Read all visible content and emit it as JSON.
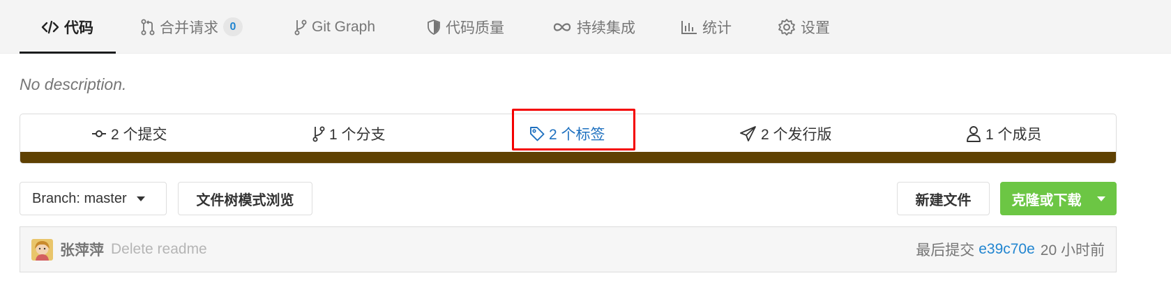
{
  "tabs": [
    {
      "label": "代码",
      "icon": "code-icon",
      "active": true
    },
    {
      "label": "合并请求",
      "icon": "merge-request-icon",
      "badge": "0"
    },
    {
      "label": "Git Graph",
      "icon": "git-branch-icon"
    },
    {
      "label": "代码质量",
      "icon": "shield-icon"
    },
    {
      "label": "持续集成",
      "icon": "infinity-icon"
    },
    {
      "label": "统计",
      "icon": "bar-chart-icon"
    },
    {
      "label": "设置",
      "icon": "gear-icon"
    }
  ],
  "repo": {
    "description": "No description."
  },
  "stats": [
    {
      "label": "2 个提交",
      "icon": "commit-icon"
    },
    {
      "label": "1 个分支",
      "icon": "branch-icon"
    },
    {
      "label": "2 个标签",
      "icon": "tag-icon",
      "highlighted": true
    },
    {
      "label": "2 个发行版",
      "icon": "paper-plane-icon"
    },
    {
      "label": "1 个成员",
      "icon": "user-icon"
    }
  ],
  "language_bar_color": "#5f4102",
  "toolbar": {
    "branch_label": "Branch: master",
    "tree_view_label": "文件树模式浏览",
    "new_file_label": "新建文件",
    "clone_label": "克隆或下载"
  },
  "last_commit": {
    "author": "张萍萍",
    "message": "Delete readme",
    "prefix": "最后提交",
    "sha": "e39c70e",
    "time": "20 小时前"
  },
  "colors": {
    "accent": "#1e70bf",
    "clone_button": "#6cc644",
    "highlight_box": "#f40000"
  }
}
